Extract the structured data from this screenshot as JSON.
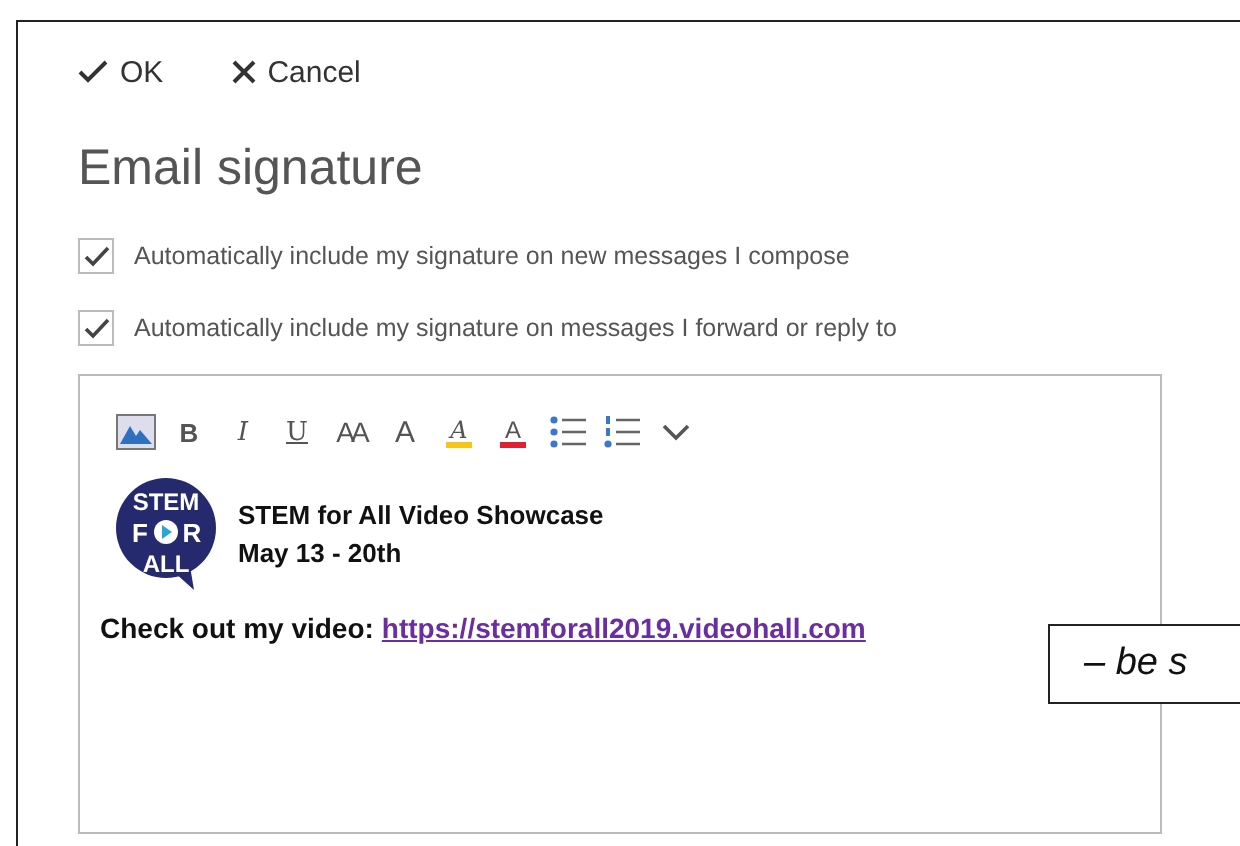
{
  "commands": [
    {
      "kind": "ok",
      "label": "OK"
    },
    {
      "kind": "cancel",
      "label": "Cancel"
    }
  ],
  "title": "Email signature",
  "options": [
    {
      "label": "Automatically include my signature on new messages I compose",
      "checked": true
    },
    {
      "label": "Automatically include my signature on messages I forward or reply to",
      "checked": true
    }
  ],
  "toolbar": [
    {
      "kind": "picture"
    },
    {
      "kind": "bold",
      "glyph": "B"
    },
    {
      "kind": "italic",
      "glyph": "I"
    },
    {
      "kind": "underline",
      "glyph": "U"
    },
    {
      "kind": "size",
      "glyph": "AA"
    },
    {
      "kind": "grow",
      "glyph": "A"
    },
    {
      "kind": "highlight",
      "glyph": "A"
    },
    {
      "kind": "color",
      "glyph": "A"
    },
    {
      "kind": "bullets"
    },
    {
      "kind": "numbers"
    },
    {
      "kind": "more"
    }
  ],
  "signature": {
    "logo": {
      "top": "STEM",
      "left": "F",
      "right": "R",
      "bottom": "ALL"
    },
    "name": "STEM for All Video Showcase",
    "dates": "May 13 - 20th",
    "prompt": "Check out my video:",
    "link": "https://stemforall2019.videohall.com"
  },
  "callout": "– be s"
}
